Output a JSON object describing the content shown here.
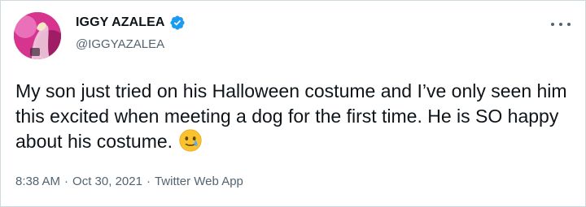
{
  "tweet": {
    "author": {
      "display_name": "IGGY AZALEA",
      "handle": "@IGGYAZALEA",
      "verified": true,
      "avatar_icon": "profile-avatar"
    },
    "text": "My son just tried on his Halloween costume and I’ve only seen him this excited when meeting a dog for the first time. He is SO happy about his costume.",
    "emoji_icon": "face-holding-back-tears-icon",
    "time": "8:38 AM",
    "date": "Oct 30, 2021",
    "separator": "·",
    "source": "Twitter Web App"
  },
  "colors": {
    "verified_blue": "#1d9bf0",
    "secondary_text": "#536471",
    "primary_text": "#0f1419"
  }
}
